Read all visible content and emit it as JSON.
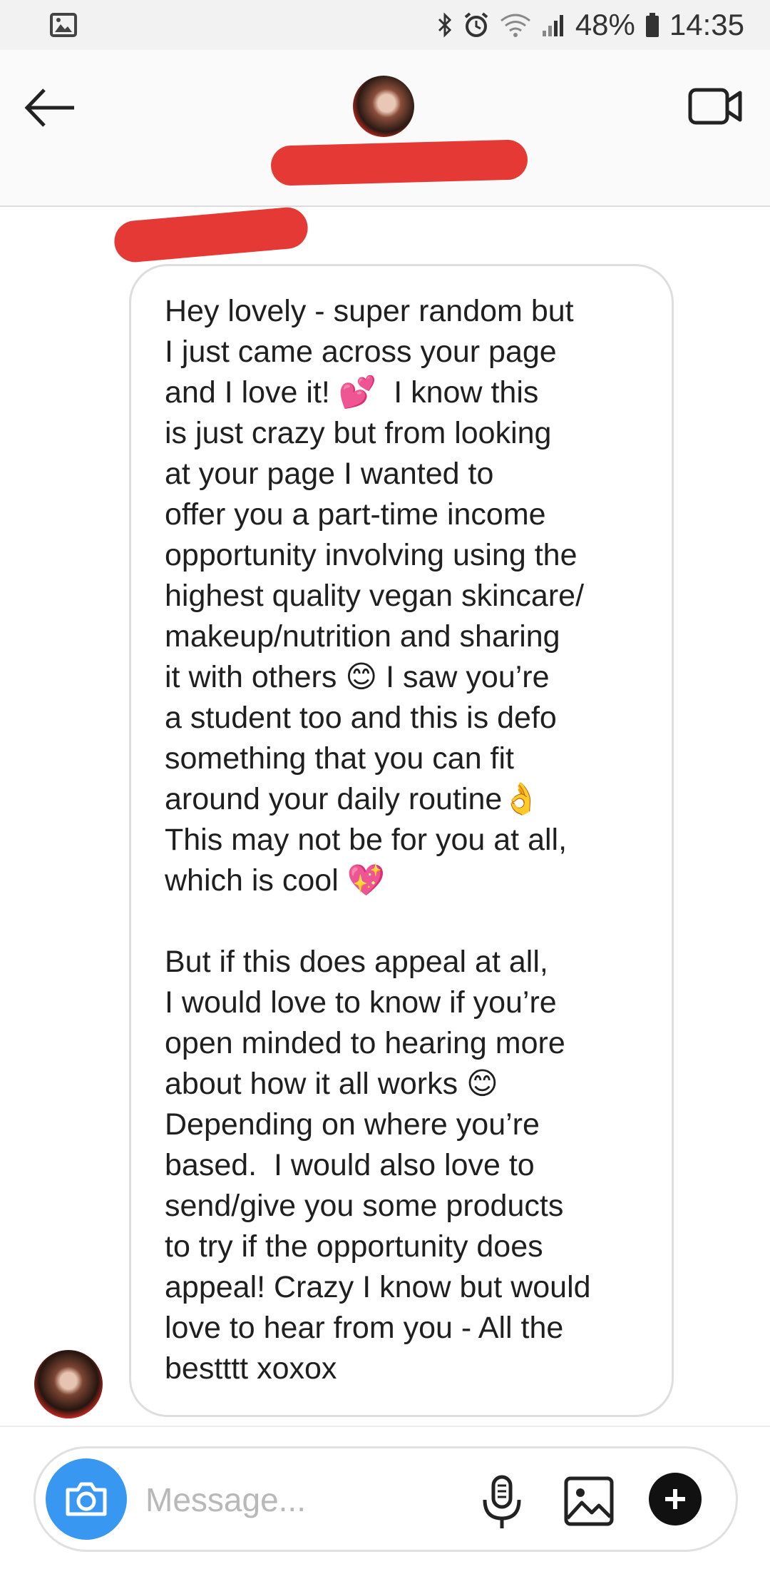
{
  "status_bar": {
    "battery": "48%",
    "time": "14:35"
  },
  "header": {
    "back_icon": "arrow-left-icon",
    "video_icon": "video-call-icon"
  },
  "conversation": {
    "message_paragraphs": [
      "Hey lovely - super random but\nI just came across your page\nand I love it! 💕  I know this\nis just crazy but from looking\nat your page I wanted to\noffer you a part-time income\nopportunity involving using the\nhighest quality vegan skincare/\nmakeup/nutrition and sharing\nit with others 😊 I saw you’re\na student too and this is defo\nsomething that you can fit\naround your daily routine👌\nThis may not be for you at all,\nwhich is cool 💖",
      "But if this does appeal at all,\nI would love to know if you’re\nopen minded to hearing more\nabout how it all works 😊\nDepending on where you’re\nbased.  I would also love to\nsend/give you some products\nto try if the opportunity does\nappeal! Crazy I know but would\nlove to hear from you - All the\nbestttt xoxox"
    ]
  },
  "composer": {
    "placeholder": "Message...",
    "icons": [
      "camera-icon",
      "microphone-icon",
      "gallery-icon",
      "plus-icon"
    ]
  },
  "colors": {
    "redaction": "#e53935",
    "camera_button": "#3897f0"
  }
}
